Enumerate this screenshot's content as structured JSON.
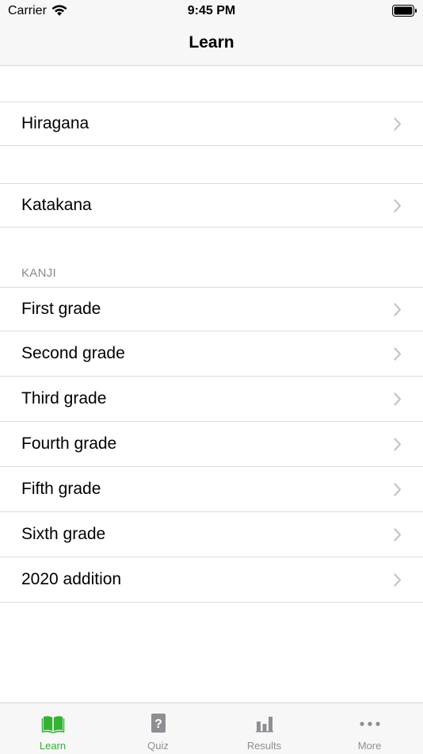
{
  "status_bar": {
    "carrier": "Carrier",
    "time": "9:45 PM"
  },
  "nav": {
    "title": "Learn"
  },
  "sections": {
    "kana": [
      {
        "label": "Hiragana"
      },
      {
        "label": "Katakana"
      }
    ],
    "kanji_header": "KANJI",
    "kanji": [
      {
        "label": "First grade"
      },
      {
        "label": "Second grade"
      },
      {
        "label": "Third grade"
      },
      {
        "label": "Fourth grade"
      },
      {
        "label": "Fifth grade"
      },
      {
        "label": "Sixth grade"
      },
      {
        "label": "2020 addition"
      }
    ]
  },
  "tab_bar": {
    "tabs": [
      {
        "label": "Learn",
        "icon": "book-icon",
        "active": true
      },
      {
        "label": "Quiz",
        "icon": "question-card-icon",
        "active": false
      },
      {
        "label": "Results",
        "icon": "bar-chart-icon",
        "active": false
      },
      {
        "label": "More",
        "icon": "ellipsis-icon",
        "active": false
      }
    ]
  },
  "colors": {
    "accent": "#34b233",
    "inactive": "#8e8e93",
    "bar_bg": "#f7f7f7"
  }
}
